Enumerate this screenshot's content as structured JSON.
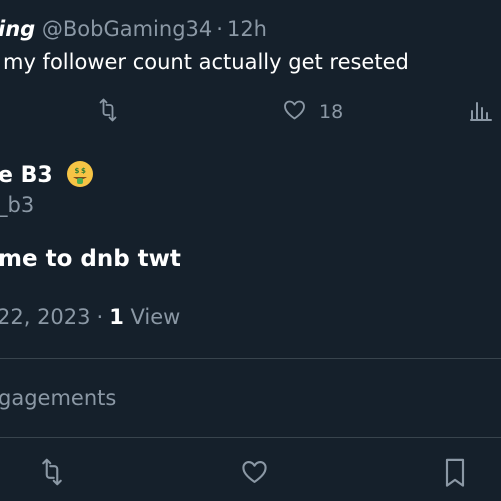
{
  "reply_tweet": {
    "author_name_partial": "ing",
    "author_handle": "@BobGaming34",
    "separator": "·",
    "time": "12h",
    "text_partial": "my follower count actually get reseted",
    "like_count": "18"
  },
  "main_tweet": {
    "author_name_partial": "e B3",
    "author_emoji": "🤑",
    "author_handle_partial": "_b3",
    "text_partial": "me to dnb twt",
    "date_partial": "22, 2023",
    "separator": "·",
    "view_count": "1",
    "view_label": "View",
    "engagements_label_partial": "gagements"
  },
  "colors": {
    "background": "#15202b",
    "text": "#ffffff",
    "muted": "#8b98a5",
    "divider": "#38444d"
  },
  "icons": [
    "retweet-icon",
    "heart-icon",
    "analytics-icon",
    "bookmark-icon"
  ]
}
